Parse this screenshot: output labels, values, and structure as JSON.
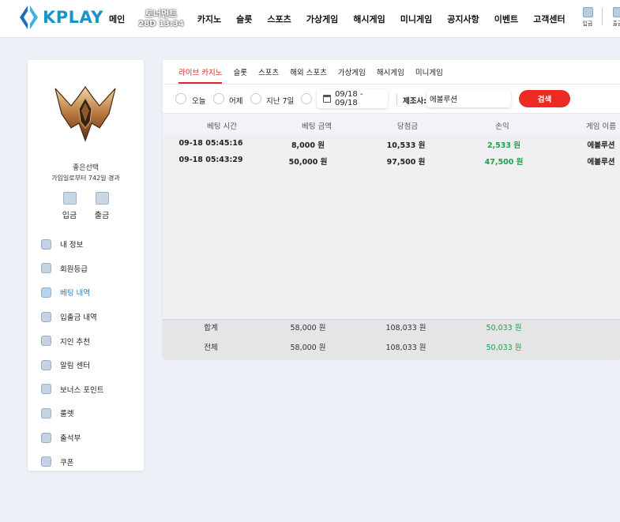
{
  "header": {
    "logo_text": "KPLAY",
    "nav": [
      "메인",
      "카지노",
      "슬롯",
      "스포츠",
      "가상게임",
      "해시게임",
      "미니게임",
      "공지사항",
      "이벤트",
      "고객센터"
    ],
    "tournament_label": "토너먼트",
    "tournament_timer": "28D 13:34",
    "deposit_label": "입금",
    "withdraw_label": "출금"
  },
  "sidebar": {
    "username": "좋은선택",
    "joined_text": "가입일로부터 742일 경과",
    "deposit_label": "입금",
    "withdraw_label": "출금",
    "menu": [
      "내 정보",
      "회원등급",
      "베팅 내역",
      "입출금 내역",
      "지인 추천",
      "알림 센터",
      "보너스 포인트",
      "룰렛",
      "출석부",
      "쿠폰"
    ],
    "active_index": 2
  },
  "main": {
    "tabs": [
      "라이브 카지노",
      "슬롯",
      "스포츠",
      "해외 스포츠",
      "가상게임",
      "해시게임",
      "미니게임"
    ],
    "active_tab": 0,
    "filters": {
      "today": "오늘",
      "yesterday": "어제",
      "last7": "지난 7일",
      "date_range": "09/18 - 09/18",
      "maker_label": "제조사:",
      "maker_value": "에볼루션",
      "search_label": "검색"
    },
    "table": {
      "headers": [
        "베팅 시간",
        "베팅 금액",
        "당첨금",
        "손익",
        "게임 이름"
      ],
      "rows": [
        [
          "09-18 05:45:16",
          "8,000 원",
          "10,533 원",
          "2,533 원",
          "에볼루션"
        ],
        [
          "09-18 05:43:29",
          "50,000 원",
          "97,500 원",
          "47,500 원",
          "에볼루션"
        ]
      ],
      "totals": [
        [
          "합계",
          "58,000 원",
          "108,033 원",
          "50,033 원"
        ],
        [
          "전체",
          "58,000 원",
          "108,033 원",
          "50,033 원"
        ]
      ]
    }
  },
  "colors": {
    "accent": "#e0281f",
    "profit": "#1ea14b",
    "brand": "#1a93c9",
    "active_menu": "#1a7fd1"
  }
}
